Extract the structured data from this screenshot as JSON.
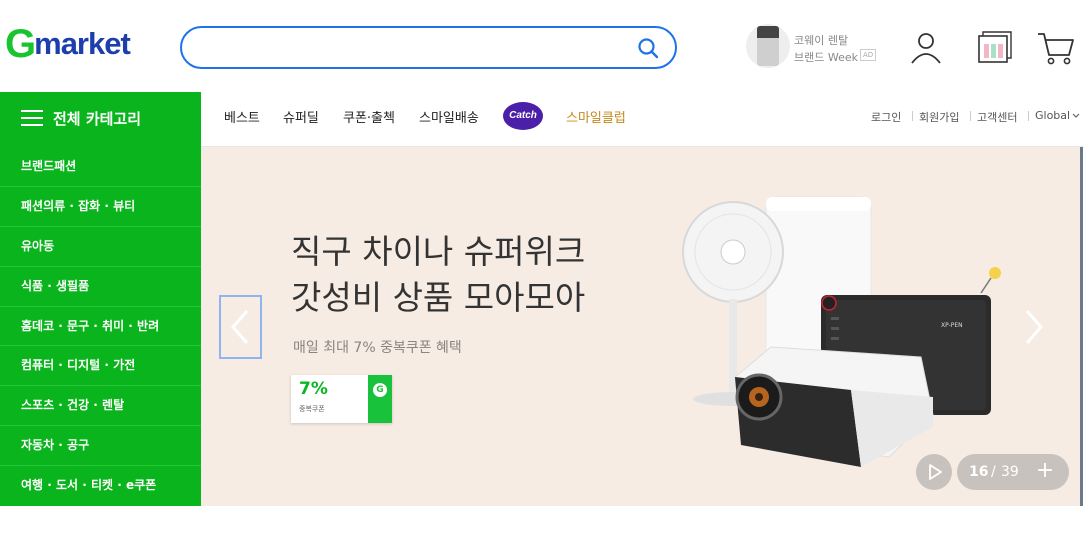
{
  "header": {
    "logo_g": "G",
    "logo_rest": "market",
    "search_placeholder": "",
    "ad": {
      "line1": "코웨이 렌탈",
      "line2": "브랜드 Week",
      "badge": "AD"
    }
  },
  "nav": {
    "all_category": "전체 카테고리",
    "menu": [
      "베스트",
      "슈퍼딜",
      "쿠폰·출첵",
      "스마일배송"
    ],
    "catch": "Catch",
    "smile_club": "스마일클럽",
    "util": [
      "로그인",
      "회원가입",
      "고객센터",
      "Global"
    ]
  },
  "sidebar": {
    "items": [
      "브랜드패션",
      "패션의류 · 잡화 · 뷰티",
      "유아동",
      "식품 · 생필품",
      "홈데코 · 문구 · 취미 · 반려",
      "컴퓨터 · 디지털 · 가전",
      "스포츠 · 건강 · 렌탈",
      "자동차 · 공구",
      "여행 · 도서 · 티켓 · e쿠폰"
    ]
  },
  "banner": {
    "headline1": "직구 차이나 슈퍼위크",
    "headline2": "갓성비 상품 모아모아",
    "sub": "매일 최대 7% 중복쿠폰 혜택",
    "coupon_pct": "7%",
    "coupon_label": "중복쿠폰",
    "coupon_g": "G",
    "tablet_brand": "XP-PEN",
    "page_current": "16",
    "page_sep": "/",
    "page_total": "39",
    "plus": "+"
  },
  "colors": {
    "brand_green": "#09b41c",
    "brand_blue": "#1d3fae",
    "search_border": "#1e73e8"
  }
}
